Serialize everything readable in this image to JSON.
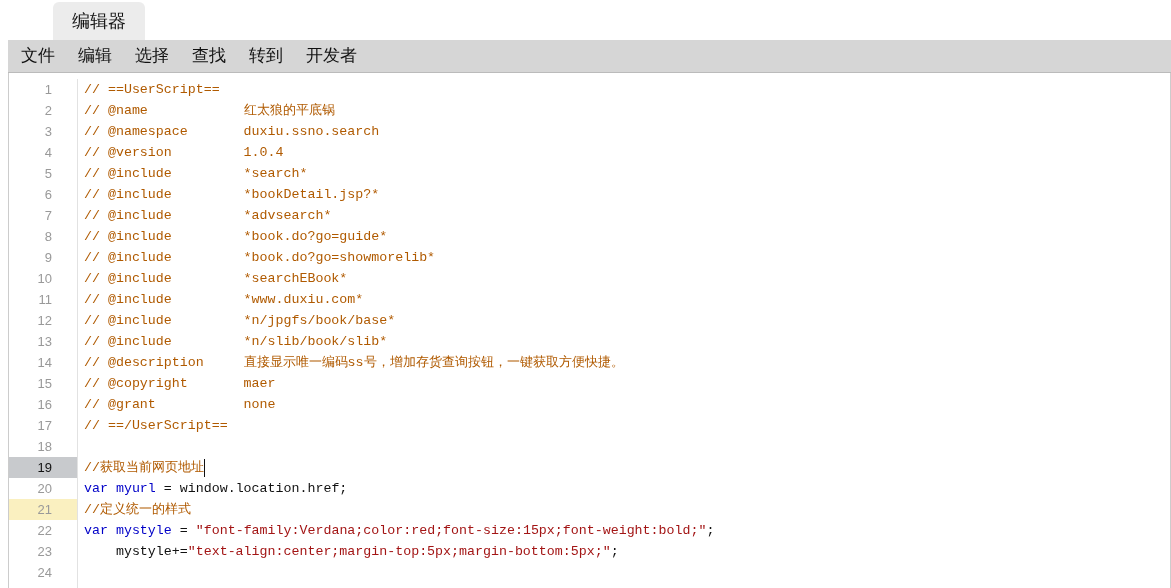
{
  "tabs": [
    {
      "label": "编辑器",
      "selected": true
    }
  ],
  "menu": [
    "文件",
    "编辑",
    "选择",
    "查找",
    "转到",
    "开发者"
  ],
  "lines": [
    {
      "number": "1",
      "current": false,
      "highlighted": false,
      "tokens": [
        {
          "kind": "comment",
          "text": "// ==UserScript=="
        }
      ]
    },
    {
      "number": "2",
      "current": false,
      "highlighted": false,
      "tokens": [
        {
          "kind": "comment",
          "text": "// @name            红太狼的平底锅"
        }
      ]
    },
    {
      "number": "3",
      "current": false,
      "highlighted": false,
      "tokens": [
        {
          "kind": "comment",
          "text": "// @namespace       duxiu.ssno.search"
        }
      ]
    },
    {
      "number": "4",
      "current": false,
      "highlighted": false,
      "tokens": [
        {
          "kind": "comment",
          "text": "// @version         1.0.4"
        }
      ]
    },
    {
      "number": "5",
      "current": false,
      "highlighted": false,
      "tokens": [
        {
          "kind": "comment",
          "text": "// @include         *search*"
        }
      ]
    },
    {
      "number": "6",
      "current": false,
      "highlighted": false,
      "tokens": [
        {
          "kind": "comment",
          "text": "// @include         *bookDetail.jsp?*"
        }
      ]
    },
    {
      "number": "7",
      "current": false,
      "highlighted": false,
      "tokens": [
        {
          "kind": "comment",
          "text": "// @include         *advsearch*"
        }
      ]
    },
    {
      "number": "8",
      "current": false,
      "highlighted": false,
      "tokens": [
        {
          "kind": "comment",
          "text": "// @include         *book.do?go=guide*"
        }
      ]
    },
    {
      "number": "9",
      "current": false,
      "highlighted": false,
      "tokens": [
        {
          "kind": "comment",
          "text": "// @include         *book.do?go=showmorelib*"
        }
      ]
    },
    {
      "number": "10",
      "current": false,
      "highlighted": false,
      "tokens": [
        {
          "kind": "comment",
          "text": "// @include         *searchEBook*"
        }
      ]
    },
    {
      "number": "11",
      "current": false,
      "highlighted": false,
      "tokens": [
        {
          "kind": "comment",
          "text": "// @include         *www.duxiu.com*"
        }
      ]
    },
    {
      "number": "12",
      "current": false,
      "highlighted": false,
      "tokens": [
        {
          "kind": "comment",
          "text": "// @include         *n/jpgfs/book/base*"
        }
      ]
    },
    {
      "number": "13",
      "current": false,
      "highlighted": false,
      "tokens": [
        {
          "kind": "comment",
          "text": "// @include         *n/slib/book/slib*"
        }
      ]
    },
    {
      "number": "14",
      "current": false,
      "highlighted": false,
      "tokens": [
        {
          "kind": "comment",
          "text": "// @description     直接显示唯一编码ss号，增加存货查询按钮，一键获取方便快捷。"
        }
      ]
    },
    {
      "number": "15",
      "current": false,
      "highlighted": false,
      "tokens": [
        {
          "kind": "comment",
          "text": "// @copyright       maer"
        }
      ]
    },
    {
      "number": "16",
      "current": false,
      "highlighted": false,
      "tokens": [
        {
          "kind": "comment",
          "text": "// @grant           none"
        }
      ]
    },
    {
      "number": "17",
      "current": false,
      "highlighted": false,
      "tokens": [
        {
          "kind": "comment",
          "text": "// ==/UserScript=="
        }
      ]
    },
    {
      "number": "18",
      "current": false,
      "highlighted": false
    },
    {
      "number": "19",
      "current": true,
      "highlighted": false,
      "tokens": [
        {
          "kind": "comment",
          "text": "//获取当前网页地址"
        }
      ]
    },
    {
      "number": "20",
      "current": false,
      "highlighted": false,
      "tokens": [
        {
          "kind": "keyword",
          "text": "var"
        },
        {
          "kind": "variable",
          "text": " myurl"
        },
        {
          "kind": "plain",
          "text": " = window.location.href;"
        }
      ]
    },
    {
      "number": "21",
      "current": false,
      "highlighted": true,
      "tokens": [
        {
          "kind": "comment",
          "text": "//定义统一的样式"
        }
      ]
    },
    {
      "number": "22",
      "current": false,
      "highlighted": false,
      "tokens": [
        {
          "kind": "keyword",
          "text": "var"
        },
        {
          "kind": "variable",
          "text": " mystyle"
        },
        {
          "kind": "plain",
          "text": " = "
        },
        {
          "kind": "string",
          "text": "\"font-family:Verdana;color:red;font-size:15px;font-weight:bold;\""
        },
        {
          "kind": "plain",
          "text": ";"
        }
      ]
    },
    {
      "number": "23",
      "current": false,
      "highlighted": false,
      "tokens": [
        {
          "kind": "plain",
          "text": "    mystyle+="
        },
        {
          "kind": "string",
          "text": "\"text-align:center;margin-top:5px;margin-bottom:5px;\""
        },
        {
          "kind": "plain",
          "text": ";"
        }
      ]
    },
    {
      "number": "24",
      "current": false,
      "highlighted": false
    }
  ]
}
